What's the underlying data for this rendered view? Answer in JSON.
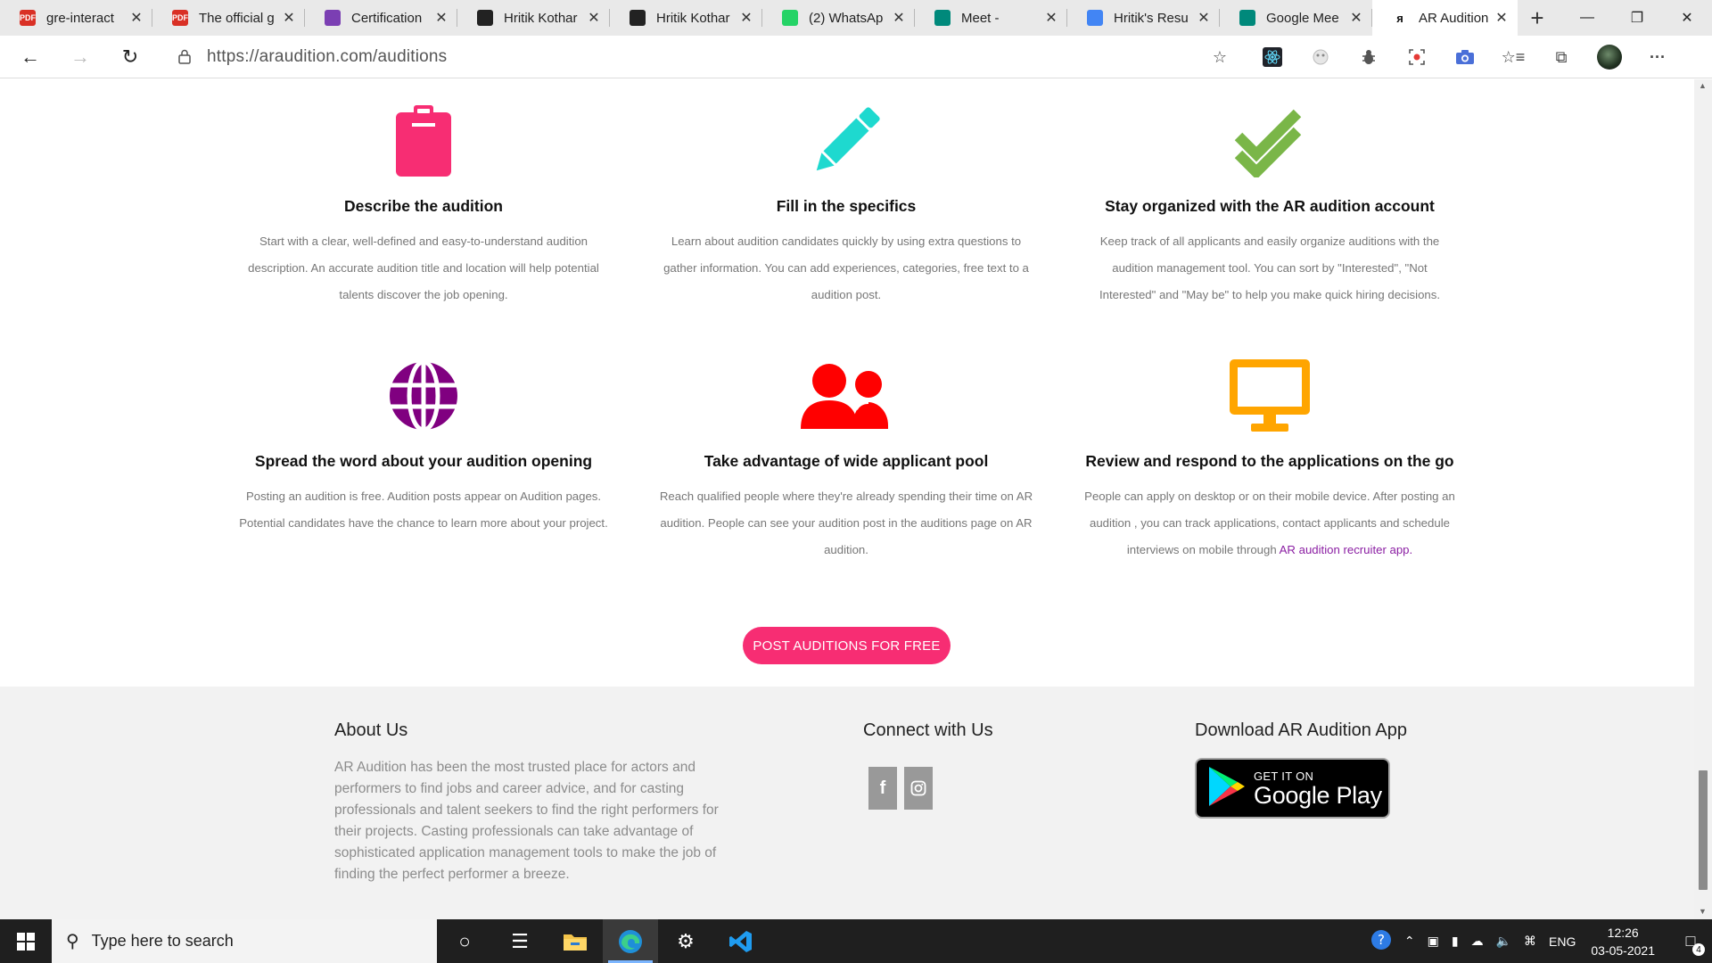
{
  "browser": {
    "tabs": [
      {
        "title": "gre-interact",
        "icon": "pdf-icon",
        "color": "#d93025"
      },
      {
        "title": "The official g",
        "icon": "pdf-icon",
        "color": "#d93025"
      },
      {
        "title": "Certification",
        "icon": "certification-icon",
        "color": "#7b3fb3"
      },
      {
        "title": "Hritik Kothar",
        "icon": "briefcase-icon",
        "color": "#222222"
      },
      {
        "title": "Hritik Kothar",
        "icon": "briefcase-icon",
        "color": "#222222"
      },
      {
        "title": "(2) WhatsAp",
        "icon": "whatsapp-icon",
        "color": "#25d366"
      },
      {
        "title": "Meet -",
        "icon": "meet-icon",
        "color": "#00897b"
      },
      {
        "title": "Hritik's Resu",
        "icon": "docs-icon",
        "color": "#4285f4"
      },
      {
        "title": "Google Mee",
        "icon": "meet-icon",
        "color": "#00897b"
      },
      {
        "title": "AR Audition",
        "icon": "ar-logo-icon",
        "color": "#111111"
      }
    ],
    "url": "https://araudition.com/auditions"
  },
  "features": [
    {
      "icon": "clipboard-icon",
      "color": "#f72d73",
      "title": "Describe the audition",
      "text": "Start with a clear, well-defined and easy-to-understand audition description. An accurate audition title and location will help potential talents discover the job opening."
    },
    {
      "icon": "pencil-icon",
      "color": "#1ed9cf",
      "title": "Fill in the specifics",
      "text": "Learn about audition candidates quickly by using extra questions to gather information. You can add experiences, categories, free text to a audition post."
    },
    {
      "icon": "double-check-icon",
      "color": "#7ab648",
      "title": "Stay organized with the AR audition account",
      "text": "Keep track of all applicants and easily organize auditions with the audition management tool. You can sort by \"Interested\", \"Not Interested\" and \"May be\" to help you make quick hiring decisions."
    },
    {
      "icon": "globe-icon",
      "color": "#800080",
      "title": "Spread the word about your audition opening",
      "text": "Posting an audition is free. Audition posts appear on Audition pages. Potential candidates have the chance to learn more about your project."
    },
    {
      "icon": "users-icon",
      "color": "#ff0000",
      "title": "Take advantage of wide applicant pool",
      "text": "Reach qualified people where they're already spending their time on AR audition. People can see your audition post in the auditions page on AR audition."
    },
    {
      "icon": "desktop-icon",
      "color": "#ffa500",
      "title": "Review and respond to the applications on the go",
      "text": "People can apply on desktop or on their mobile device. After posting an audition , you can track applications, contact applicants and schedule interviews on mobile through ",
      "link": "AR audition recruiter app."
    }
  ],
  "cta": "POST AUDITIONS FOR FREE",
  "footer": {
    "about_title": "About Us",
    "about_text": "AR Audition has been the most trusted place for actors and performers to find jobs and career advice, and for casting professionals and talent seekers to find the right performers for their projects. Casting professionals can take advantage of sophisticated application management tools to make the job of finding the perfect performer a breeze.",
    "connect_title": "Connect with Us",
    "social": [
      {
        "icon": "facebook-icon",
        "glyph": "f"
      },
      {
        "icon": "instagram-icon",
        "glyph": "◎"
      }
    ],
    "download_title": "Download AR Audition App",
    "badge_small": "GET IT ON",
    "badge_big": "Google Play"
  },
  "taskbar": {
    "search_placeholder": "Type here to search",
    "language": "ENG",
    "time": "12:26",
    "date": "03-05-2021",
    "notifications": "4"
  }
}
